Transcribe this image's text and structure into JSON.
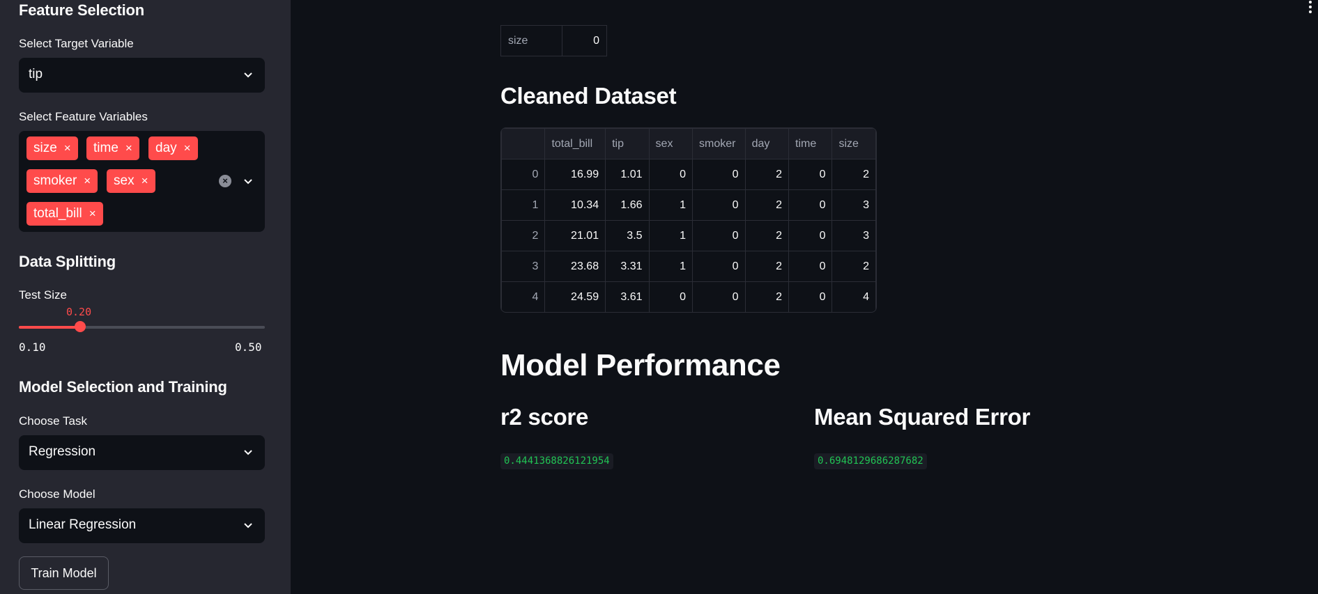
{
  "sidebar": {
    "feature_heading": "Feature Selection",
    "target_label": "Select Target Variable",
    "target_value": "tip",
    "features_label": "Select Feature Variables",
    "features": [
      "size",
      "time",
      "day",
      "smoker",
      "sex",
      "total_bill"
    ],
    "tag_remove": "×",
    "clear_all": "×",
    "split_heading": "Data Splitting",
    "test_size_label": "Test Size",
    "test_size_value": "0.20",
    "test_size_fraction": 0.25,
    "test_size_min": "0.10",
    "test_size_max": "0.50",
    "model_heading": "Model Selection and Training",
    "task_label": "Choose Task",
    "task_value": "Regression",
    "model_label": "Choose Model",
    "model_value": "Linear Regression",
    "train_button": "Train Model"
  },
  "main": {
    "top_table": [
      {
        "key": "size",
        "value": "0"
      }
    ],
    "cleaned_heading": "Cleaned Dataset",
    "columns": [
      "",
      "total_bill",
      "tip",
      "sex",
      "smoker",
      "day",
      "time",
      "size"
    ],
    "rows": [
      [
        "0",
        "16.99",
        "1.01",
        "0",
        "0",
        "2",
        "0",
        "2"
      ],
      [
        "1",
        "10.34",
        "1.66",
        "1",
        "0",
        "2",
        "0",
        "3"
      ],
      [
        "2",
        "21.01",
        "3.5",
        "1",
        "0",
        "2",
        "0",
        "3"
      ],
      [
        "3",
        "23.68",
        "3.31",
        "1",
        "0",
        "2",
        "0",
        "2"
      ],
      [
        "4",
        "24.59",
        "3.61",
        "0",
        "0",
        "2",
        "0",
        "4"
      ]
    ],
    "performance_heading": "Model Performance",
    "r2_heading": "r2 score",
    "r2_value": "0.4441368826121954",
    "mse_heading": "Mean Squared Error",
    "mse_value": "0.6948129686287682"
  },
  "colors": {
    "accent": "#ff4b4b",
    "sidebar_bg": "#262730",
    "main_bg": "#0e1117",
    "metric_text": "#21c354"
  },
  "icons": {
    "dropdown": "chevron-down-icon",
    "menu": "kebab-menu-icon",
    "clear": "clear-all-icon"
  }
}
